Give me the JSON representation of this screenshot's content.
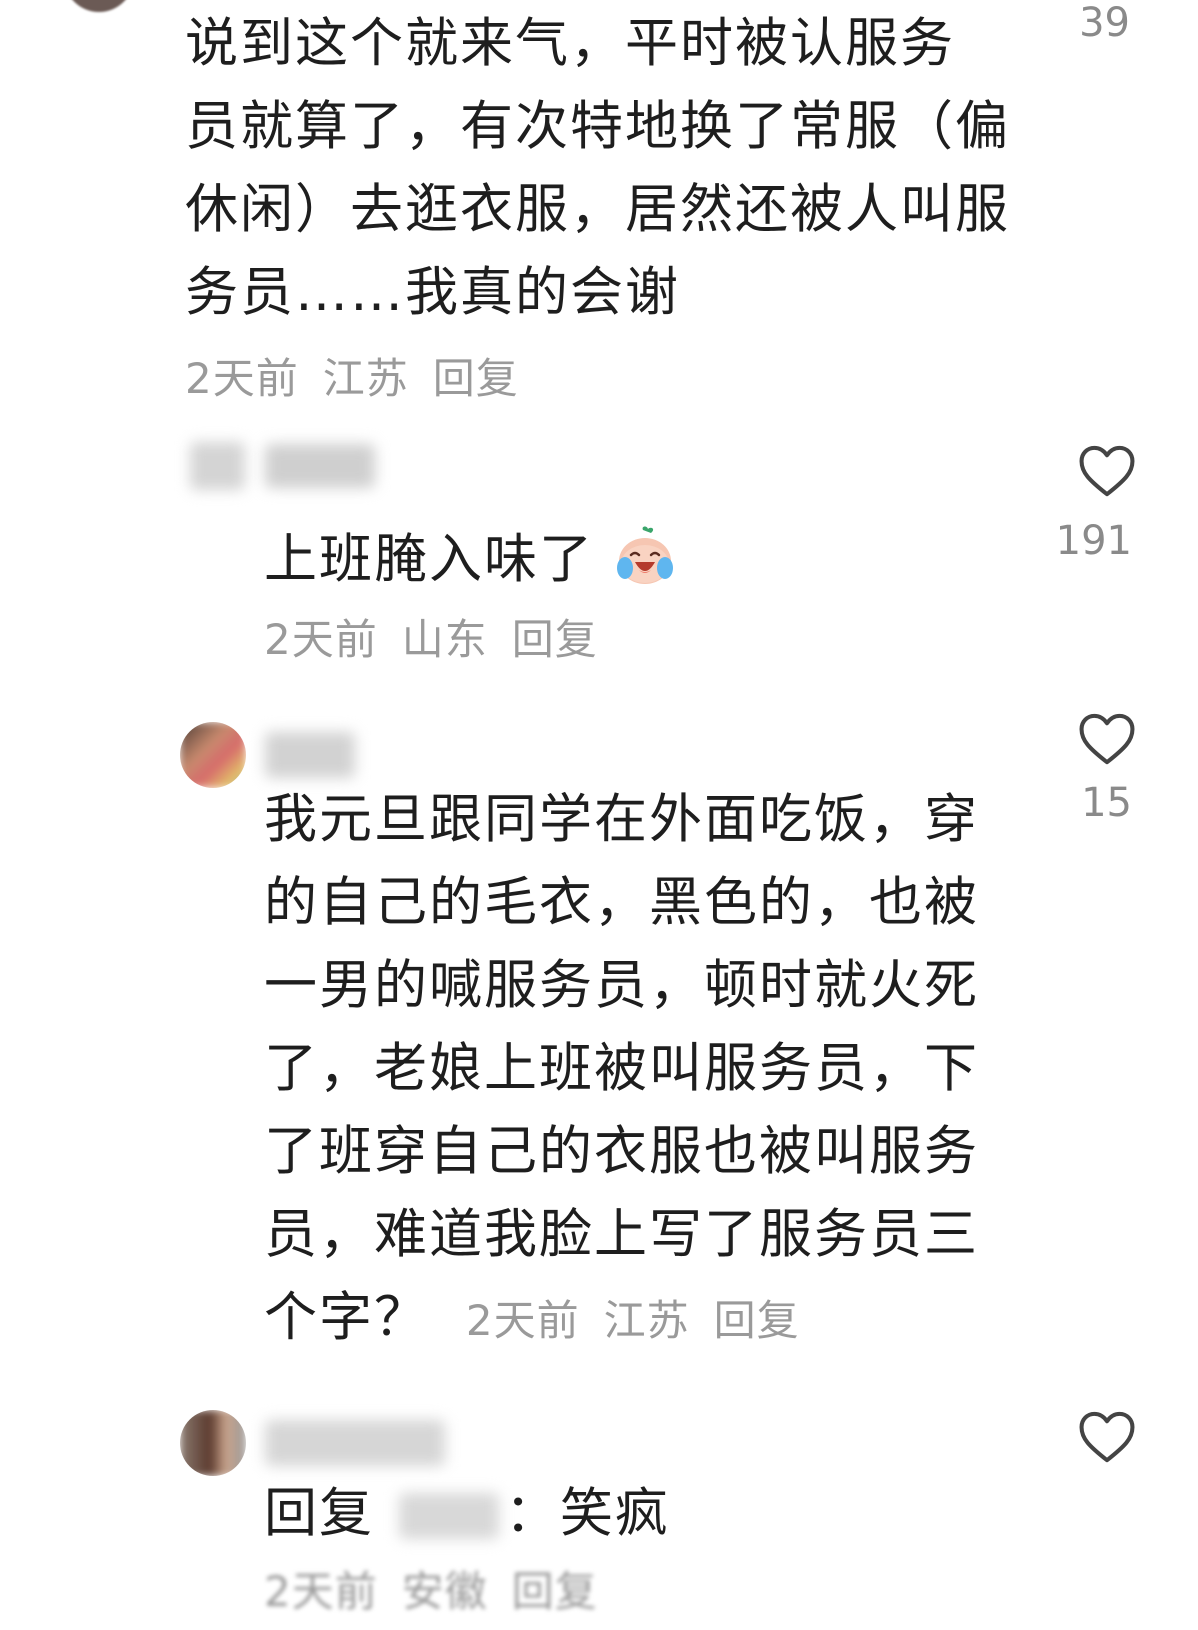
{
  "comments": [
    {
      "text_lines": [
        "说到这个就来气，平时被认服务",
        "员就算了，有次特地换了常服（偏",
        "休闲）去逛衣服，居然还被人叫服",
        "务员……我真的会谢"
      ],
      "time": "2天前",
      "location": "江苏",
      "reply_label": "回复",
      "likes": "39"
    },
    {
      "text_lines": [
        "上班腌入味了"
      ],
      "emoji": "crying-laughing-emoji",
      "time": "2天前",
      "location": "山东",
      "reply_label": "回复",
      "likes": "191"
    },
    {
      "text_lines": [
        "我元旦跟同学在外面吃饭，穿",
        "的自己的毛衣，黑色的，也被",
        "一男的喊服务员，顿时就火死",
        "了，老娘上班被叫服务员，下",
        "了班穿自己的衣服也被叫服务",
        "员，难道我脸上写了服务员三"
      ],
      "last_line": "个字？",
      "time": "2天前",
      "location": "江苏",
      "reply_label": "回复",
      "likes": "15"
    },
    {
      "reply_prefix": "回复",
      "reply_suffix": "：笑疯",
      "time": "2天前",
      "location": "安徽",
      "reply_label": "回复"
    }
  ],
  "icons": {
    "like": "heart-outline-icon"
  },
  "colors": {
    "text": "#1e1e1e",
    "meta": "#9a9a9a",
    "count": "#8a8a8a",
    "heart_stroke": "#444444"
  }
}
